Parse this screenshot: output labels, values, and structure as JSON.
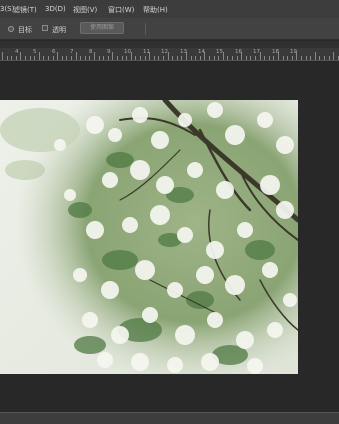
{
  "menubar": {
    "items": [
      "3(S)",
      "滤镜(T)",
      "3D(D)",
      "视图(V)",
      "窗口(W)",
      "帮助(H)"
    ]
  },
  "options": {
    "target_label": "目标",
    "transparent_label": "透明",
    "use_pattern_button": "使用图案"
  },
  "ruler": {
    "labels": [
      "4",
      "5",
      "6",
      "7",
      "8",
      "9",
      "10",
      "11",
      "12",
      "13",
      "14",
      "15",
      "16",
      "17",
      "18",
      "19"
    ]
  },
  "canvas": {
    "image_subject": "photo of white cherry blossom tree branches against a pale sky"
  },
  "colors": {
    "app_bg": "#282828",
    "menubar_bg": "#3c3c3c",
    "options_bg": "#424242",
    "ruler_bg": "#3a3a3a"
  }
}
